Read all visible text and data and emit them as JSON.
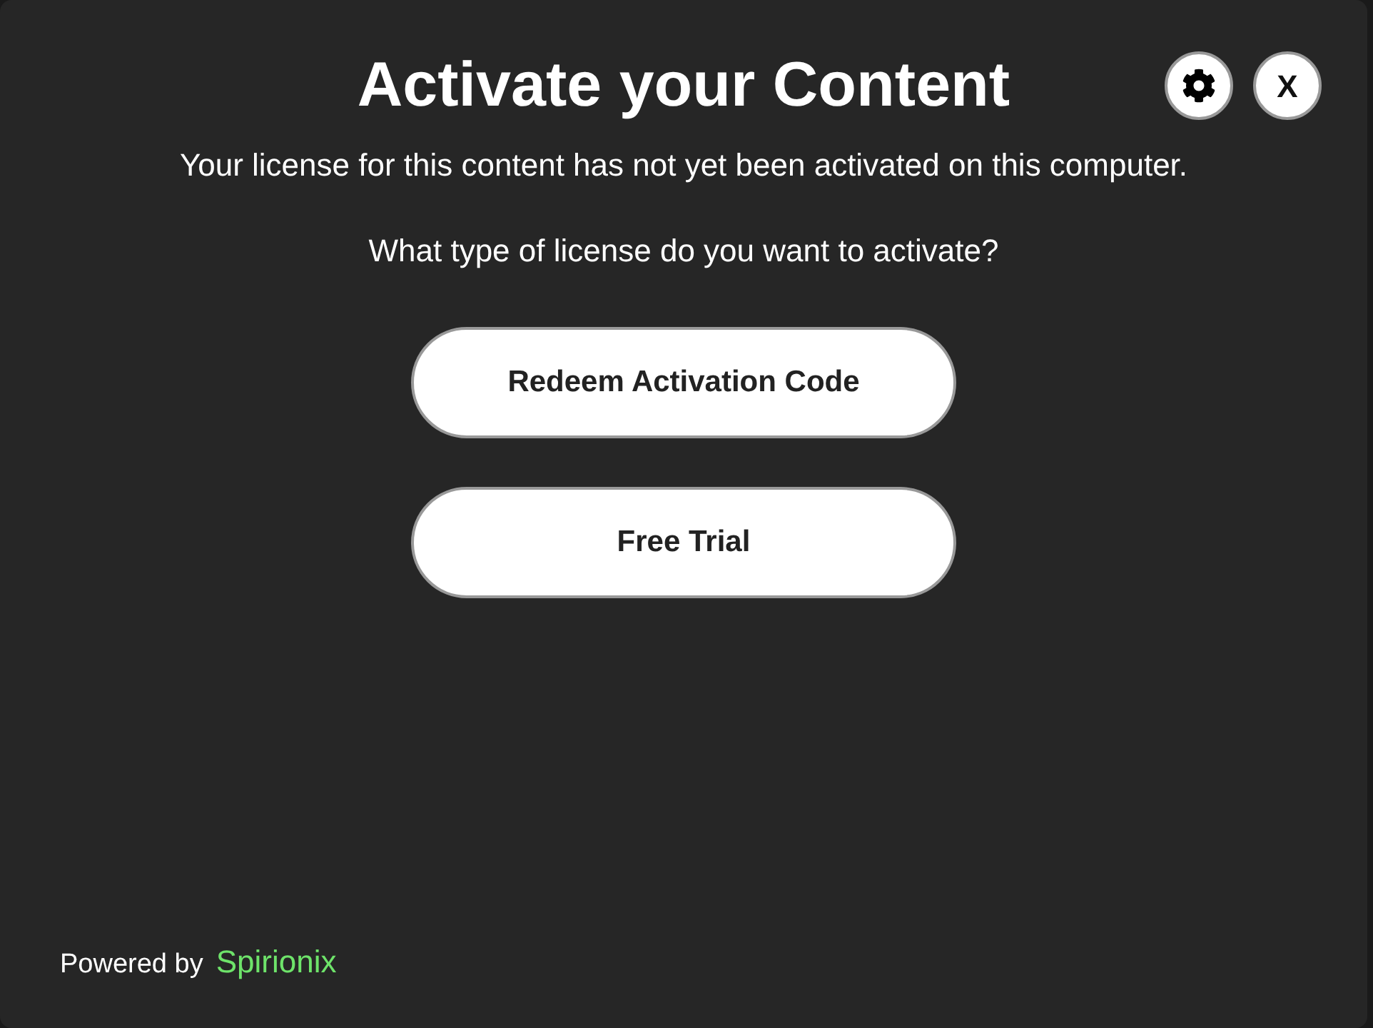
{
  "dialog": {
    "title": "Activate your Content",
    "close_label": "X",
    "message": "Your license for this content has not yet been activated on this computer.",
    "question": "What type of license do you want to activate?",
    "options": [
      {
        "label": "Redeem Activation Code"
      },
      {
        "label": "Free Trial"
      }
    ],
    "footer": {
      "prefix": "Powered by",
      "brand": "Spirionix"
    }
  }
}
